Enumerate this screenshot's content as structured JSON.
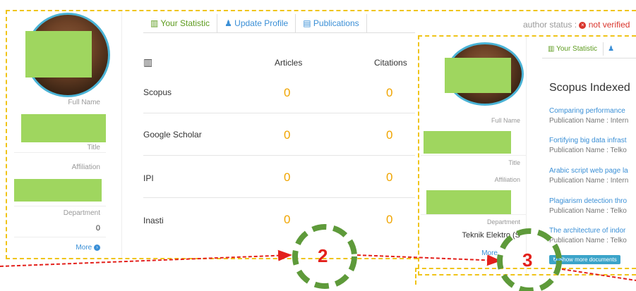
{
  "panel1": {
    "sidebar": {
      "full_name_label": "Full Name",
      "title_label": "Title",
      "affiliation_label": "Affiliation",
      "department_label": "Department",
      "department_value": "0",
      "more": "More"
    },
    "tabs": [
      {
        "label": "Your Statistic",
        "icon": "bar-chart-icon"
      },
      {
        "label": "Update Profile",
        "icon": "user-icon"
      },
      {
        "label": "Publications",
        "icon": "book-icon"
      }
    ],
    "author_status": {
      "label": "author status :",
      "value": "not verified"
    },
    "stats": {
      "columns": [
        "Articles",
        "Citations"
      ],
      "rows": [
        {
          "name": "Scopus",
          "articles": "0",
          "citations": "0"
        },
        {
          "name": "Google Scholar",
          "articles": "0",
          "citations": "0"
        },
        {
          "name": "IPI",
          "articles": "0",
          "citations": "0"
        },
        {
          "name": "Inasti",
          "articles": "0",
          "citations": "0"
        }
      ]
    }
  },
  "panel2": {
    "sidebar": {
      "full_name_label": "Full Name",
      "title_label": "Title",
      "affiliation_label": "Affiliation",
      "department_label": "Department",
      "department_value": "Teknik Elektro (S",
      "more": "More"
    },
    "tabs": [
      {
        "label": "Your Statistic",
        "icon": "bar-chart-icon"
      }
    ],
    "section_title": "Scopus Indexed",
    "documents": [
      {
        "title": "Comparing performance",
        "publication": "Publication Name : Intern"
      },
      {
        "title": "Fortifying big data infrast",
        "publication": "Publication Name : Telko"
      },
      {
        "title": "Arabic script web page la",
        "publication": "Publication Name : Intern"
      },
      {
        "title": "Plagiarism detection thro",
        "publication": "Publication Name : Telko"
      },
      {
        "title": "The architecture of indor",
        "publication": "Publication Name : Telko"
      }
    ],
    "show_more": "Show more documents"
  },
  "annotations": {
    "step2": "2",
    "step3": "3"
  },
  "colors": {
    "accent_green": "#5d9b1e",
    "link_blue": "#3a8fd6",
    "value_orange": "#f0a500",
    "annotation_red": "#e3201b",
    "circle_green": "#5e9a3a",
    "dashed_yellow": "#f0c419"
  }
}
